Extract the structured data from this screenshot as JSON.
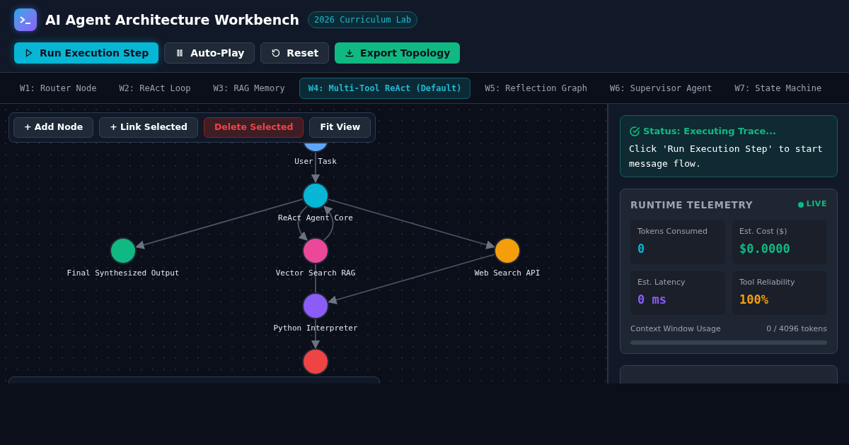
{
  "header": {
    "title": "AI Agent Architecture Workbench",
    "badge": "2026 Curriculum Lab"
  },
  "actions": [
    {
      "label": "Run Execution Step",
      "kind": "primary"
    },
    {
      "label": "Auto-Play",
      "kind": "secondary"
    },
    {
      "label": "Reset",
      "kind": "secondary"
    },
    {
      "label": "Export Topology",
      "kind": "success"
    }
  ],
  "tabs": [
    {
      "label": "W1: Router Node",
      "selected": false
    },
    {
      "label": "W2: ReAct Loop",
      "selected": false
    },
    {
      "label": "W3: RAG Memory",
      "selected": false
    },
    {
      "label": "W4: Multi-Tool ReAct (Default)",
      "selected": true
    },
    {
      "label": "W5: Reflection Graph",
      "selected": false
    },
    {
      "label": "W6: Supervisor Agent",
      "selected": false
    },
    {
      "label": "W7: State Machine",
      "selected": false
    }
  ],
  "canvas_toolbar": [
    {
      "label": "+ Add Node",
      "kind": "normal"
    },
    {
      "label": "+ Link Selected",
      "kind": "normal"
    },
    {
      "label": "Delete Selected",
      "kind": "danger"
    },
    {
      "label": "Fit View",
      "kind": "normal"
    }
  ],
  "graph": {
    "nodes": [
      {
        "label": "User Task",
        "color": "#60a5fa"
      },
      {
        "label": "ReAct Agent Core",
        "color": "#06b6d4"
      },
      {
        "label": "Final Synthesized Output",
        "color": "#10b981"
      },
      {
        "label": "Vector Search RAG",
        "color": "#ec4899"
      },
      {
        "label": "Web Search API",
        "color": "#f59e0b"
      },
      {
        "label": "Python Interpreter",
        "color": "#8b5cf6"
      },
      {
        "color": "#ef4444"
      }
    ]
  },
  "status": {
    "title": "Status: Executing Trace...",
    "message": "Click 'Run Execution Step' to start message flow."
  },
  "telemetry": {
    "title": "RUNTIME TELEMETRY",
    "live": "LIVE",
    "metrics": [
      {
        "label": "Tokens Consumed",
        "value": "0",
        "color": "#06b6d4"
      },
      {
        "label": "Est. Cost ($)",
        "value": "$0.0000",
        "color": "#10b981"
      },
      {
        "label": "Est. Latency",
        "value": "0 ms",
        "color": "#8b5cf6"
      },
      {
        "label": "Tool Reliability",
        "value": "100%",
        "color": "#f59e0b"
      }
    ],
    "context": {
      "label": "Context Window Usage",
      "reading": "0 / 4096 tokens",
      "level": 0
    }
  }
}
